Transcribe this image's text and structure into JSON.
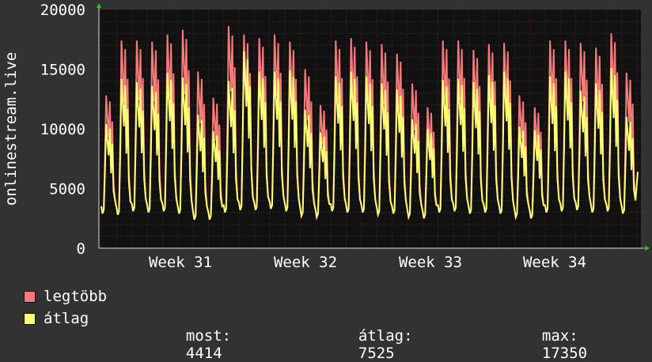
{
  "chart_data": {
    "type": "line",
    "title": "",
    "ylabel": "onlinestream.live",
    "xlabel": "",
    "ylim": [
      0,
      20000
    ],
    "yticks": [
      0,
      5000,
      10000,
      15000,
      20000
    ],
    "ytick_labels": [
      "0",
      "5000",
      "10000",
      "15000",
      "20000"
    ],
    "xtick_labels": [
      "Week 31",
      "Week 32",
      "Week 33",
      "Week 34"
    ],
    "grid": true,
    "legend_position": "bottom-left",
    "x_unit": "day",
    "peak_max": [
      12800,
      17400,
      17400,
      17300,
      17900,
      18300,
      14800,
      12600,
      18600,
      17900,
      17600,
      17900,
      17300,
      15000,
      12000,
      17400,
      17600,
      17300,
      17100,
      16300,
      13800,
      11800,
      17400,
      17400,
      16600,
      17100,
      17200,
      12800,
      11800,
      17400,
      17400,
      17200,
      16800,
      18000,
      14700
    ],
    "peak_avg": [
      10400,
      14200,
      13900,
      13600,
      14700,
      14300,
      11200,
      9800,
      14000,
      16500,
      14800,
      14800,
      14900,
      11600,
      9700,
      14400,
      14800,
      14400,
      13800,
      13300,
      10800,
      10000,
      14100,
      14200,
      13900,
      14500,
      14800,
      10200,
      9900,
      14400,
      14800,
      13200,
      13800,
      15100,
      11000
    ],
    "trough": [
      2900,
      2800,
      3100,
      3000,
      3100,
      2900,
      2400,
      2400,
      3000,
      3200,
      3200,
      3300,
      3100,
      2700,
      2600,
      3100,
      3000,
      3000,
      2800,
      2900,
      2600,
      2500,
      3000,
      3100,
      2900,
      3000,
      2900,
      2600,
      2500,
      3000,
      3100,
      3200,
      3000,
      3100,
      2900
    ],
    "series": [
      {
        "name": "legtöbb",
        "color": "#f57a7a"
      },
      {
        "name": "átlag",
        "color": "#ffff77"
      }
    ],
    "stats": {
      "most_label": "most:",
      "most": "4414",
      "atlag_label": "átlag:",
      "atlag": "7525",
      "max_label": "max:",
      "max": "17350"
    }
  },
  "colors": {
    "background": "#323232",
    "plot": "#111111",
    "grid_major": "#5a2020",
    "grid_minor": "#3a3a3a",
    "max_line": "#f57a7a",
    "avg_line": "#ffff77",
    "axis_arrow": "#22cc22"
  }
}
